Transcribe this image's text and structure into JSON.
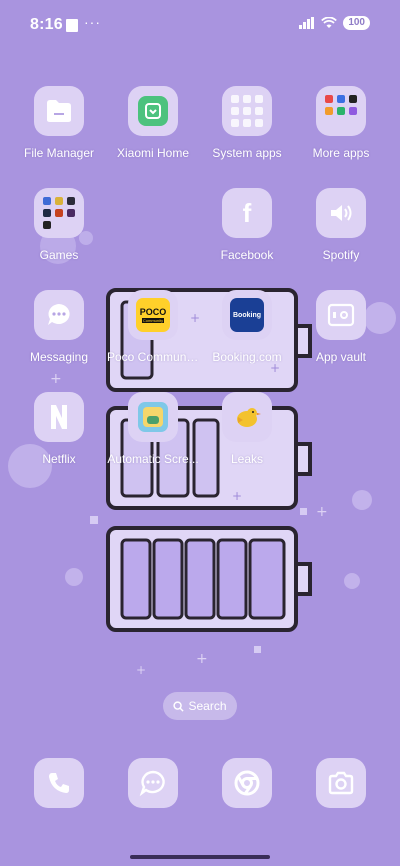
{
  "status_bar": {
    "time": "8:16",
    "dots": "···",
    "battery": "100"
  },
  "apps": {
    "file_manager": "File Manager",
    "xiaomi_home": "Xiaomi Home",
    "system_apps": "System apps",
    "more_apps": "More apps",
    "games": "Games",
    "facebook": "Facebook",
    "spotify": "Spotify",
    "messaging": "Messaging",
    "poco_community": "Poco Communi...",
    "booking": "Booking.com",
    "app_vault": "App vault",
    "netflix": "Netflix",
    "automatic_screen": "Automatic Scre...",
    "leaks": "Leaks"
  },
  "icon_text": {
    "poco_logo": "POCO",
    "poco_sub": "Community",
    "booking_logo": "Booking"
  },
  "search": {
    "label": "Search"
  },
  "dock": {
    "items": [
      "phone-icon",
      "messages-icon",
      "browser-icon",
      "camera-icon"
    ]
  },
  "colors": {
    "wallpaper": "#a994df",
    "icon_tile": "#ddd2f4",
    "accent": "#8f7cc7"
  }
}
